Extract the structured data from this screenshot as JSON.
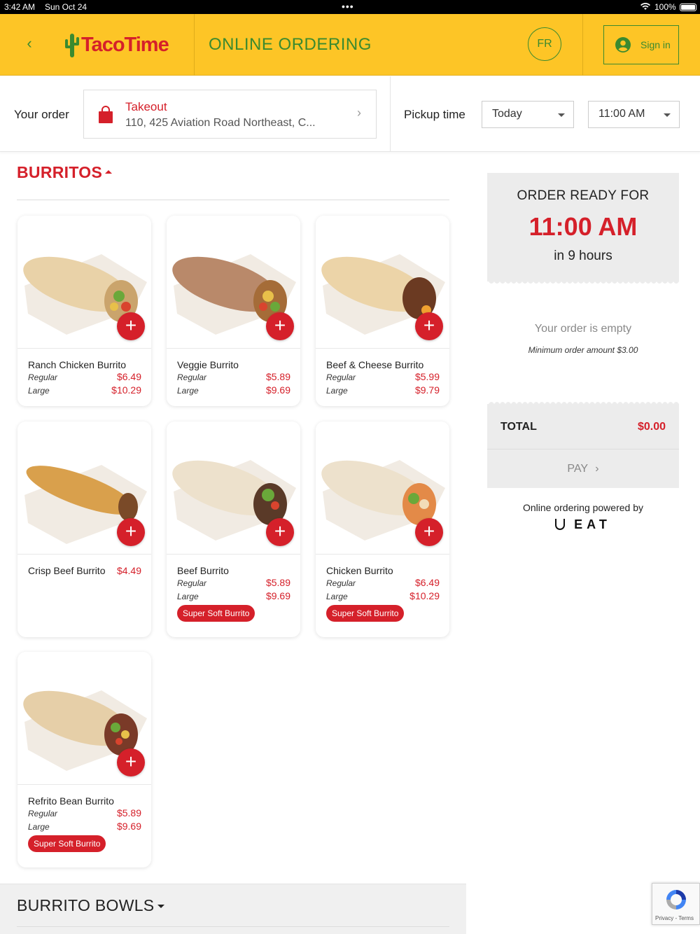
{
  "status": {
    "time": "3:42 AM",
    "date": "Sun Oct 24",
    "battery": "100%"
  },
  "header": {
    "brand": "TacoTime",
    "title": "ONLINE ORDERING",
    "lang": "FR",
    "signin": "Sign in",
    "colors": {
      "yellow": "#fdc526",
      "green": "#3b8a2f",
      "red": "#d5202a"
    }
  },
  "order": {
    "your_order_label": "Your order",
    "mode": "Takeout",
    "address": "110, 425 Aviation Road Northeast, C...",
    "pickup_label": "Pickup time",
    "day": "Today",
    "time": "11:00 AM"
  },
  "section": {
    "title": "BURRITOS"
  },
  "items": [
    {
      "name": "Ranch Chicken Burrito",
      "regular_label": "Regular",
      "regular": "$6.49",
      "large_label": "Large",
      "large": "$10.29"
    },
    {
      "name": "Veggie Burrito",
      "regular_label": "Regular",
      "regular": "$5.89",
      "large_label": "Large",
      "large": "$9.69"
    },
    {
      "name": "Beef & Cheese Burrito",
      "regular_label": "Regular",
      "regular": "$5.99",
      "large_label": "Large",
      "large": "$9.79"
    },
    {
      "name": "Crisp Beef Burrito",
      "price": "$4.49"
    },
    {
      "name": "Beef Burrito",
      "regular_label": "Regular",
      "regular": "$5.89",
      "large_label": "Large",
      "large": "$9.69",
      "tag": "Super Soft Burrito"
    },
    {
      "name": "Chicken Burrito",
      "regular_label": "Regular",
      "regular": "$6.49",
      "large_label": "Large",
      "large": "$10.29",
      "tag": "Super Soft Burrito"
    },
    {
      "name": "Refrito Bean Burrito",
      "regular_label": "Regular",
      "regular": "$5.89",
      "large_label": "Large",
      "large": "$9.69",
      "tag": "Super Soft Burrito"
    }
  ],
  "cart": {
    "ready_label": "ORDER READY FOR",
    "ready_time": "11:00 AM",
    "ready_in": "in 9 hours",
    "empty": "Your order is empty",
    "minimum": "Minimum order amount $3.00",
    "total_label": "TOTAL",
    "total_value": "$0.00",
    "pay": "PAY",
    "powered": "Online ordering powered by",
    "provider": "EAT"
  },
  "next_section": {
    "title": "BURRITO BOWLS"
  },
  "recaptcha": {
    "text": "Privacy - Terms"
  }
}
